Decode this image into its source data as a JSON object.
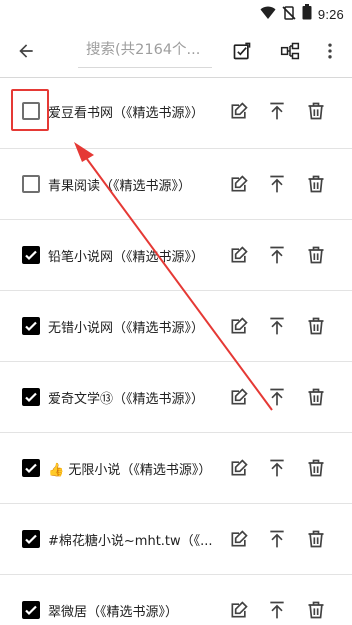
{
  "status_bar": {
    "time": "9:26",
    "icons": [
      "wifi-icon",
      "no-sim-icon",
      "battery-icon"
    ]
  },
  "toolbar": {
    "back_icon": "arrow-left-icon",
    "search_placeholder": "搜索(共2164个...",
    "actions": [
      "edit-check-icon",
      "group-icon",
      "more-vert-icon"
    ]
  },
  "sources": [
    {
      "name": "爱豆看书网（《精选书源》）",
      "checked": false
    },
    {
      "name": "青果阅读（《精选书源》）",
      "checked": false
    },
    {
      "name": "铅笔小说网（《精选书源》）",
      "checked": true
    },
    {
      "name": "无错小说网（《精选书源》）",
      "checked": true
    },
    {
      "name": "爱奇文学⑬（《精选书源》）",
      "checked": true
    },
    {
      "name": "👍 无限小说（《精选书源》）",
      "checked": true
    },
    {
      "name": "#棉花糖小说~mht.tw（《...",
      "checked": true
    },
    {
      "name": "翠微居（《精选书源》）",
      "checked": true
    }
  ],
  "row_actions": [
    "edit-icon",
    "move-to-top-icon",
    "delete-icon"
  ],
  "colors": {
    "accent_annotation": "#e53935",
    "checkbox_on": "#000000",
    "divider": "#e3e3e3",
    "icon": "#424242"
  }
}
